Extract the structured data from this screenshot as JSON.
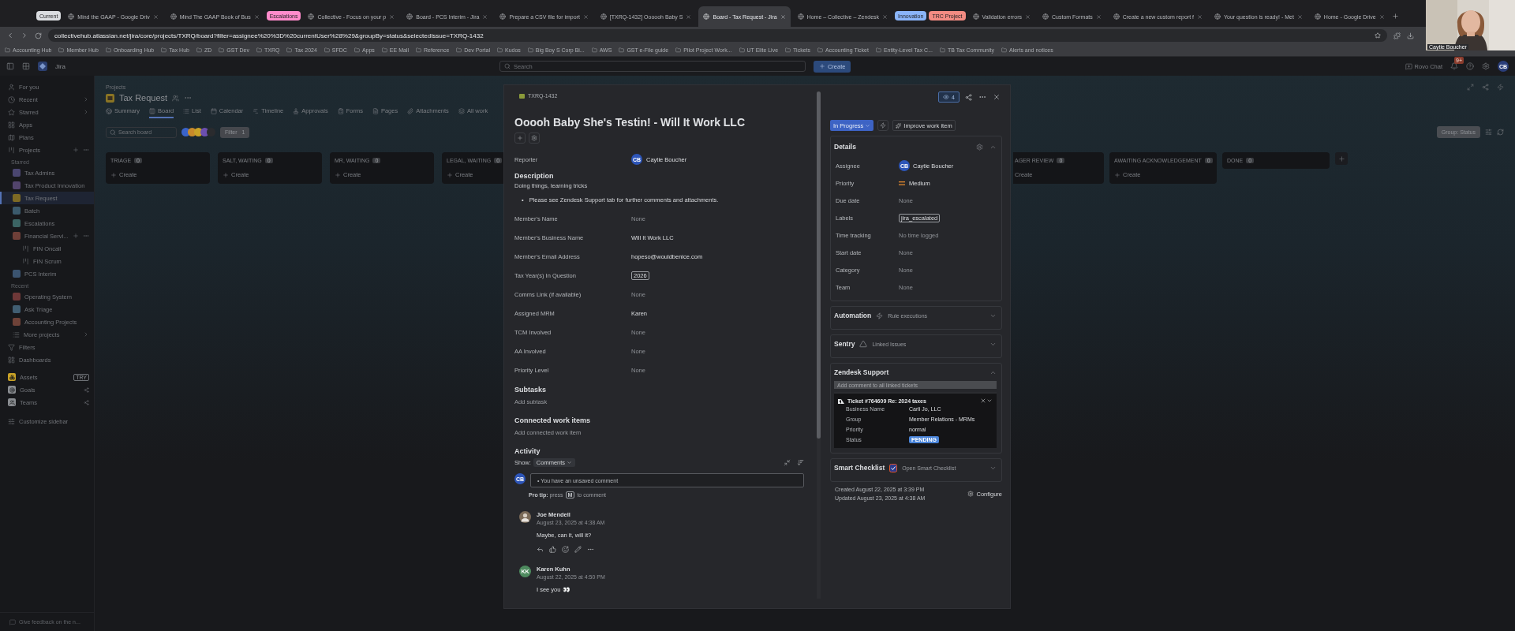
{
  "browser": {
    "tabs": [
      {
        "kind": "group",
        "label": "Current",
        "color": "#dadce0"
      },
      {
        "kind": "tab",
        "label": "Mind the GAAP - Google Driv",
        "selected": false
      },
      {
        "kind": "tab",
        "label": "Mind The GAAP Book of Bus",
        "selected": false
      },
      {
        "kind": "group",
        "label": "Escalations",
        "color": "#ff8bcb"
      },
      {
        "kind": "tab",
        "label": "Collective - Focus on your p",
        "selected": false
      },
      {
        "kind": "tab",
        "label": "Board - PCS Interim - Jira",
        "selected": false
      },
      {
        "kind": "tab",
        "label": "Prepare a CSV file for import",
        "selected": false
      },
      {
        "kind": "tab",
        "label": "[TXRQ-1432] Oooooh Baby S",
        "selected": false
      },
      {
        "kind": "tab",
        "label": "Board - Tax Request - Jira",
        "selected": true
      },
      {
        "kind": "tab",
        "label": "Home – Collective – Zendesk",
        "selected": false
      },
      {
        "kind": "group",
        "label": "Innovation",
        "color": "#8ab4f8"
      },
      {
        "kind": "group",
        "label": "TRC Project",
        "color": "#f28b82"
      },
      {
        "kind": "tab",
        "label": "Validation errors",
        "selected": false
      },
      {
        "kind": "tab",
        "label": "Custom Formats",
        "selected": false
      },
      {
        "kind": "tab",
        "label": "Create a new custom report f",
        "selected": false
      },
      {
        "kind": "tab",
        "label": "Your question is ready! - Met",
        "selected": false
      },
      {
        "kind": "tab",
        "label": "Home - Google Drive",
        "selected": false
      }
    ],
    "url": "collectivehub.atlassian.net/jira/core/projects/TXRQ/board?filter=assignee%20%3D%20currentUser%28%29&groupBy=status&selectedIssue=TXRQ-1432",
    "bookmarks": [
      "Accounting Hub",
      "Member Hub",
      "Onboarding Hub",
      "Tax Hub",
      "ZD",
      "GST Dev",
      "TXRQ",
      "Tax 2024",
      "SFDC",
      "Apps",
      "EE Mall",
      "Reference",
      "Dev Portal",
      "Kudos",
      "Big Boy S Corp Bi...",
      "AWS",
      "GST e-File guide",
      "Pilot Project Work...",
      "UT Elite Live",
      "Tickets",
      "Accounting Ticket",
      "Entity-Level Tax C...",
      "TB Tax Community",
      "Alerts and notices"
    ],
    "video": {
      "caption": "Caytie Boucher"
    }
  },
  "topnav": {
    "product": "Jira",
    "search_placeholder": "Search",
    "create": "Create",
    "rovo": "Rovo Chat",
    "notifications": "9+",
    "avatar": "CB"
  },
  "sidebar": {
    "nav": [
      {
        "label": "For you",
        "expandable": false
      },
      {
        "label": "Recent",
        "expandable": true
      },
      {
        "label": "Starred",
        "expandable": true
      },
      {
        "label": "Apps",
        "expandable": false
      },
      {
        "label": "Plans",
        "expandable": false
      }
    ],
    "projects_label": "Projects",
    "starred_heading": "Starred",
    "starred": [
      {
        "label": "Tax Admins",
        "color": "#4a4670",
        "selected": false
      },
      {
        "label": "Tax Product Innovation",
        "color": "#52446c",
        "selected": false
      },
      {
        "label": "Tax Request",
        "color": "#7d6a24",
        "selected": true
      },
      {
        "label": "Batch",
        "color": "#3b5a6c",
        "selected": false
      },
      {
        "label": "Escalations",
        "color": "#3b6464",
        "selected": false
      },
      {
        "label": "Financial Servi...",
        "color": "#6e3f38",
        "selected": false,
        "children": [
          {
            "label": "FIN Oncall",
            "selected": false
          },
          {
            "label": "FIN Scrum",
            "selected": false
          }
        ]
      },
      {
        "label": "PCS Interim",
        "color": "#3b5470",
        "selected": false
      }
    ],
    "recent_heading": "Recent",
    "recent": [
      {
        "label": "Operating System",
        "color": "#6e3838",
        "selected": false
      },
      {
        "label": "Ask Triage",
        "color": "#415e72",
        "selected": false
      },
      {
        "label": "Accounting Projects",
        "color": "#6e4238",
        "selected": false
      }
    ],
    "more": "More projects",
    "bottom": [
      "Filters",
      "Dashboards"
    ],
    "apps": [
      {
        "label": "Assets",
        "badge": "TRY",
        "color": "#c9a227"
      },
      {
        "label": "Goals",
        "color": "#8a8d91"
      },
      {
        "label": "Teams",
        "color": "#8a8d91"
      }
    ],
    "customize": "Customize sidebar",
    "feedback": "Give feedback on the n..."
  },
  "board": {
    "breadcrumb": "Projects",
    "title": "Tax Request",
    "tabs": [
      {
        "label": "Summary",
        "selected": false
      },
      {
        "label": "Board",
        "selected": true
      },
      {
        "label": "List",
        "selected": false
      },
      {
        "label": "Calendar",
        "selected": false
      },
      {
        "label": "Timeline",
        "selected": false
      },
      {
        "label": "Approvals",
        "selected": false
      },
      {
        "label": "Forms",
        "selected": false
      },
      {
        "label": "Pages",
        "selected": false
      },
      {
        "label": "Attachments",
        "selected": false
      },
      {
        "label": "All work",
        "selected": false
      }
    ],
    "search_placeholder": "Search board",
    "avatars": [
      {
        "color": "#3a63c9"
      },
      {
        "color": "#c98a2a"
      },
      {
        "color": "#c9a227"
      },
      {
        "color": "#6c4fb0"
      },
      {
        "color": "#2a2b2e"
      }
    ],
    "filter": "Filter",
    "filter_count": "1",
    "group": "Group: Status",
    "columns_left": [
      {
        "title": "TRIAGE",
        "count": "0",
        "create": "Create"
      },
      {
        "title": "SALT, WAITING",
        "count": "0",
        "create": "Create"
      },
      {
        "title": "MR, WAITING",
        "count": "0",
        "create": "Create"
      },
      {
        "title": "LEGAL, WAITING",
        "count": "0",
        "create": "Create"
      }
    ],
    "columns_right": [
      {
        "title": "AGER REVIEW",
        "count": "0",
        "create": "Create",
        "partial": true
      },
      {
        "title": "AWAITING ACKNOWLEDGEMENT",
        "count": "0",
        "create": "Create",
        "partial": false
      },
      {
        "title": "DONE",
        "count": "0",
        "partial": false
      }
    ]
  },
  "issue": {
    "key": "TXRQ-1432",
    "watchers": "4",
    "title": "Ooooh Baby She's Testin! - Will It Work LLC",
    "reporter": {
      "label": "Reporter",
      "initials": "CB",
      "name": "Caytie Boucher"
    },
    "description": {
      "heading": "Description",
      "text": "Doing things, learning tricks",
      "marker": "•",
      "bullet": "Please see Zendesk Support tab for further comments and attachments."
    },
    "fields": [
      {
        "label": "Member's Name",
        "value": "None",
        "kind": "none"
      },
      {
        "label": "Member's Business Name",
        "value": "Will It Work LLC",
        "kind": "plain"
      },
      {
        "label": "Member's Email Address",
        "value": "hopeso@wouldbenice.com",
        "kind": "plain"
      },
      {
        "label": "Tax Year(s) In Question",
        "value": "2026",
        "kind": "tag"
      },
      {
        "label": "Comms Link (if available)",
        "value": "None",
        "kind": "none"
      },
      {
        "label": "Assigned MRM",
        "value": "Karen",
        "kind": "plain"
      },
      {
        "label": "TCM Involved",
        "value": "None",
        "kind": "none"
      },
      {
        "label": "AA Involved",
        "value": "None",
        "kind": "none"
      },
      {
        "label": "Priority Level",
        "value": "None",
        "kind": "none"
      }
    ],
    "subtasks": {
      "heading": "Subtasks",
      "action": "Add subtask"
    },
    "connected": {
      "heading": "Connected work items",
      "action": "Add connected work item"
    },
    "activity": {
      "heading": "Activity",
      "show": "Show:",
      "filter": "Comments",
      "avatar": "CB",
      "comment_placeholder": "• You have an unsaved comment",
      "tip": "**Pro tip:** press",
      "tip_key": "M",
      "tip_end": "to comment",
      "comments": [
        {
          "author": "Joe Mendell",
          "date": "August 23, 2025 at 4:38 AM",
          "text": "Maybe, can it, will it?",
          "actions": true
        },
        {
          "author": "Karen Kuhn",
          "date": "August 22, 2025 at 4:50 PM",
          "text": "I see you 👀",
          "kind": "initials",
          "initials": "KK",
          "color": "#4d8a5e",
          "actions": false
        }
      ]
    },
    "status": "In Progress",
    "improve": "Improve work item",
    "details": {
      "heading": "Details",
      "rows": [
        {
          "label": "Assignee",
          "value": "Caytie Boucher",
          "kind": "person",
          "initials": "CB"
        },
        {
          "label": "Priority",
          "value": "Medium",
          "kind": "priority"
        },
        {
          "label": "Due date",
          "value": "None",
          "kind": "none"
        },
        {
          "label": "Labels",
          "value": "jira_escalated",
          "kind": "tag"
        },
        {
          "label": "Time tracking",
          "value": "No time logged",
          "kind": "none"
        },
        {
          "label": "Start date",
          "value": "None",
          "kind": "none"
        },
        {
          "label": "Category",
          "value": "None",
          "kind": "none"
        },
        {
          "label": "Team",
          "value": "None",
          "kind": "none"
        }
      ]
    },
    "panels": [
      {
        "kind": "automation",
        "title": "Automation",
        "sub": "Rule executions",
        "expanded": false
      },
      {
        "kind": "sentry",
        "title": "Sentry",
        "sub": "Linked Issues",
        "expanded": false
      },
      {
        "kind": "zendesk",
        "title": "Zendesk Support",
        "expanded": true,
        "placeholder": "Add comment to all linked tickets",
        "ticket": "Ticket #764609 Re: 2024 taxes",
        "rows": [
          {
            "label": "Business Name",
            "value": "Carli Jo, LLC",
            "kind": "plain"
          },
          {
            "label": "Group",
            "value": "Member Relations - MRMs",
            "kind": "plain"
          },
          {
            "label": "Priority",
            "value": "normal",
            "kind": "plain"
          },
          {
            "label": "Status",
            "value": "PENDING",
            "kind": "status"
          }
        ]
      },
      {
        "kind": "checklist",
        "title": "Smart Checklist",
        "sub": "Open Smart Checklist",
        "expanded": false
      }
    ],
    "created": "Created August 22, 2025 at 3:39 PM",
    "updated": "Updated August 23, 2025 at 4:38 AM",
    "configure": "Configure"
  }
}
